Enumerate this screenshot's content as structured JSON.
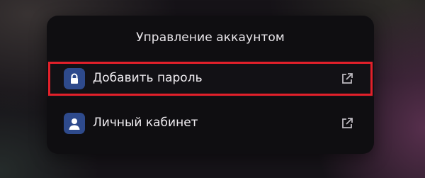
{
  "dialog": {
    "title": "Управление аккаунтом",
    "items": [
      {
        "label": "Добавить пароль",
        "icon": "lock-icon",
        "trailing_icon": "external-link-icon",
        "focused": true
      },
      {
        "label": "Личный кабинет",
        "icon": "user-icon",
        "trailing_icon": "external-link-icon",
        "focused": false
      }
    ]
  },
  "colors": {
    "icon_background": "#2e4a8c",
    "focus_border": "#e2202a",
    "dialog_background": "#0f0e11"
  }
}
